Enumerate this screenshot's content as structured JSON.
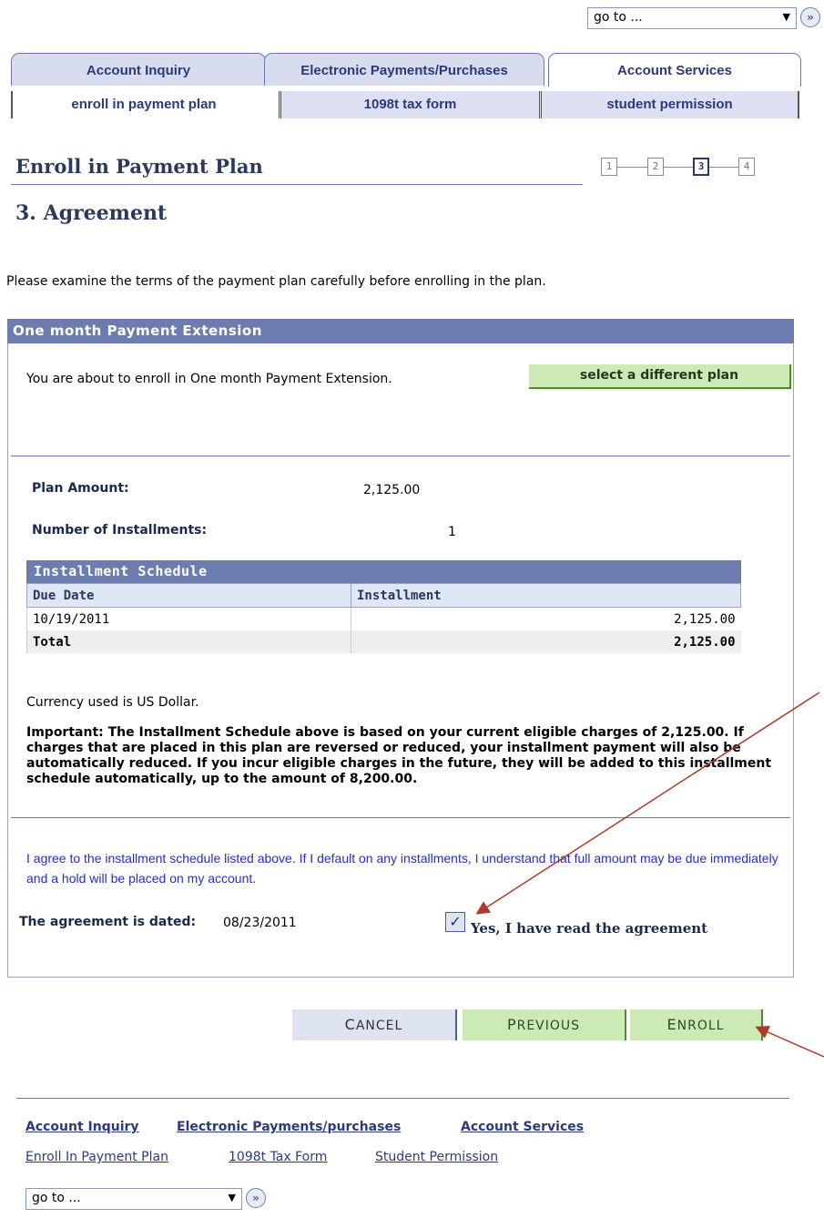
{
  "goto": {
    "label": "go to ...",
    "arrow": "▼",
    "go_icon": "»"
  },
  "tabs": [
    {
      "label": "Account Inquiry"
    },
    {
      "label": "Electronic Payments/Purchases"
    },
    {
      "label": "Account Services"
    }
  ],
  "subtabs": [
    {
      "label": "enroll in payment plan"
    },
    {
      "label": "1098t tax form"
    },
    {
      "label": "student permission"
    }
  ],
  "page": {
    "title": "Enroll in Payment Plan",
    "step_title": "3. Agreement"
  },
  "steps": [
    "1",
    "2",
    "3",
    "4"
  ],
  "intro": "Please examine the terms of the payment plan carefully before enrolling in the plan.",
  "plan": {
    "header": "One month Payment Extension",
    "enroll_text": "You are about to enroll in One month Payment Extension.",
    "select_button": "select a different plan",
    "amount_label": "Plan Amount:",
    "amount_value": "2,125.00",
    "installments_label": "Number of Installments:",
    "installments_value": "1"
  },
  "schedule": {
    "title": "Installment Schedule",
    "col_due": "Due Date",
    "col_installment": "Installment",
    "row_date": "10/19/2011",
    "row_amount": "2,125.00",
    "total_label": "Total",
    "total_amount": "2,125.00"
  },
  "currency_note": "Currency used is US Dollar.",
  "important": "Important:  The Installment Schedule above is based on your current eligible charges of 2,125.00.  If charges that are placed in this plan are reversed or reduced, your installment payment will also be automatically reduced.  If you incur eligible charges in the future, they will be added to this installment schedule automatically, up to the amount of 8,200.00.",
  "agreement": {
    "text": "I agree to the installment schedule listed above.  If I default on any installments, I understand that full amount may be due immediately and a hold will be placed on my account.",
    "dated_label": "The agreement is dated:",
    "dated_value": "08/23/2011",
    "checkbox_label": "Yes, I have read the agreement",
    "checked": true
  },
  "buttons": {
    "cancel_first": "C",
    "cancel_rest": "ANCEL",
    "previous_first": "P",
    "previous_rest": "REVIOUS",
    "enroll_first": "E",
    "enroll_rest": "NROLL"
  },
  "footer": {
    "links_primary": [
      "Account Inquiry",
      "Electronic Payments/purchases",
      "Account Services"
    ],
    "links_secondary": [
      "Enroll In Payment Plan",
      "1098t Tax Form",
      "Student Permission"
    ]
  },
  "colors": {
    "header_bg": "#6d7cae",
    "green_button": "#ccebb4",
    "link": "#2b3a7a",
    "annotation_arrow": "#b03a2e"
  }
}
